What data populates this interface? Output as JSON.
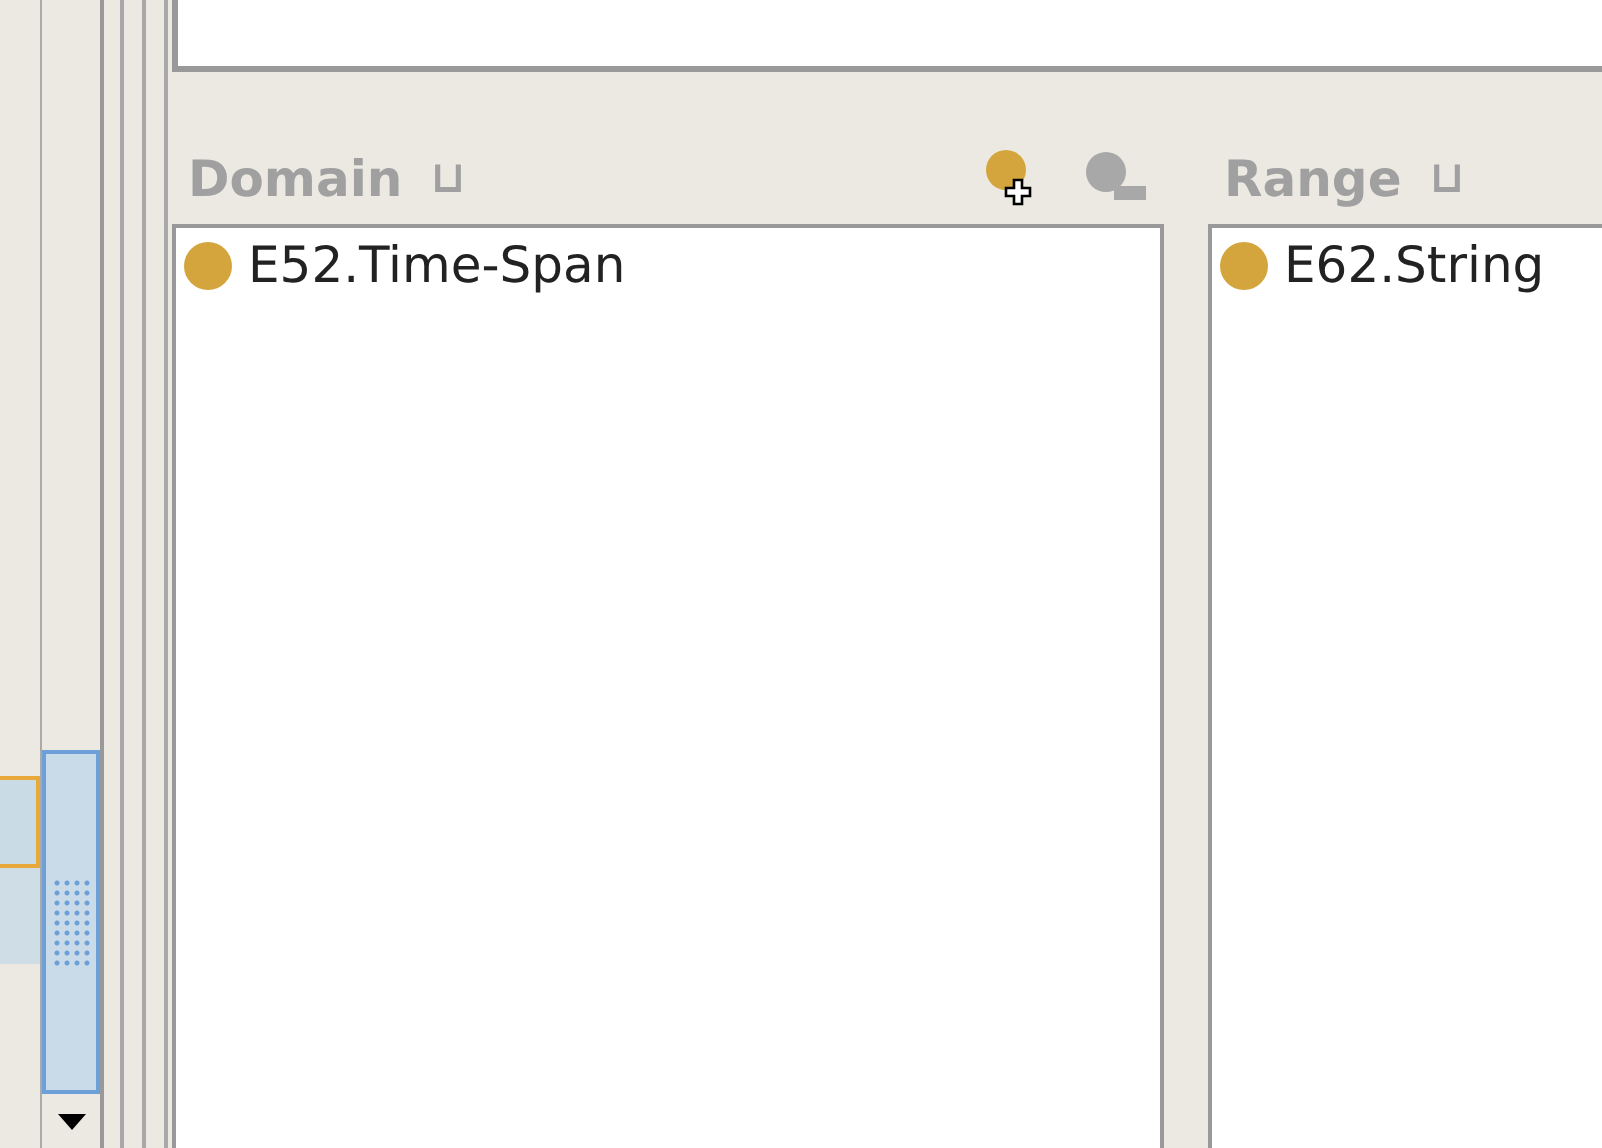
{
  "left_list": {
    "rows": [
      {
        "selected": true
      },
      {
        "selected": false
      }
    ]
  },
  "domain": {
    "title": "Domain",
    "operator": "⊔",
    "add_button": {
      "disabled": false
    },
    "remove_button": {
      "disabled": true
    },
    "items": [
      {
        "label": "E52.Time-Span",
        "color": "#d4a53c"
      }
    ]
  },
  "range": {
    "title": "Range",
    "operator": "⊔",
    "items": [
      {
        "label": "E62.String",
        "color": "#d4a53c"
      }
    ]
  }
}
